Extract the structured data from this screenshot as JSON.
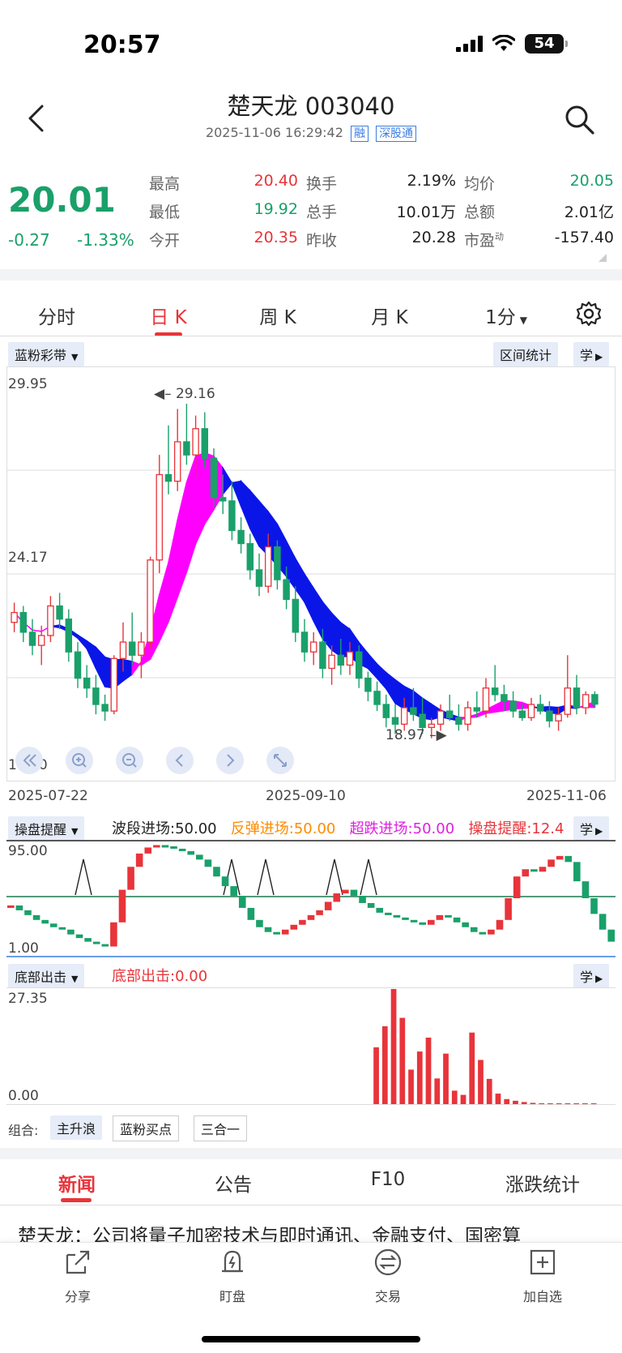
{
  "status_bar": {
    "time": "20:57",
    "battery": "54"
  },
  "header": {
    "title": "楚天龙 003040",
    "datetime": "2025-11-06 16:29:42",
    "tags": [
      "融",
      "深股通"
    ]
  },
  "quote": {
    "price": "20.01",
    "change": "-0.27",
    "change_pct": "-1.33%",
    "fields": [
      {
        "label": "最高",
        "value": "20.40",
        "color": "red"
      },
      {
        "label": "换手",
        "value": "2.19%",
        "color": "dark"
      },
      {
        "label": "均价",
        "value": "20.05",
        "color": "green"
      },
      {
        "label": "最低",
        "value": "19.92",
        "color": "green"
      },
      {
        "label": "总手",
        "value": "10.01万",
        "color": "dark"
      },
      {
        "label": "总额",
        "value": "2.01亿",
        "color": "dark"
      },
      {
        "label": "今开",
        "value": "20.35",
        "color": "red"
      },
      {
        "label": "昨收",
        "value": "20.28",
        "color": "dark"
      },
      {
        "label": "市盈",
        "value": "-157.40",
        "color": "dark",
        "sup": "动"
      }
    ]
  },
  "chart_tabs": {
    "items": [
      "分时",
      "日 K",
      "周 K",
      "月 K",
      "1分"
    ],
    "active": "日 K"
  },
  "kline_panel": {
    "indicator_label": "蓝粉彩带",
    "interval_stats": "区间统计",
    "learn": "学",
    "y_top": "29.95",
    "y_mid": "24.17",
    "y_bottom": "18.00",
    "high_label": "29.16",
    "low_label": "18.97",
    "x_labels": [
      "2025-07-22",
      "2025-09-10",
      "2025-11-06"
    ]
  },
  "osc_panel": {
    "indicator_label": "操盘提醒",
    "legend": [
      {
        "text": "波段进场:50.00",
        "color": "#222222"
      },
      {
        "text": "反弹进场:50.00",
        "color": "#ff8a00"
      },
      {
        "text": "超跌进场:50.00",
        "color": "#e020e0"
      },
      {
        "text": "操盘提醒:12.4",
        "color": "#e8343a"
      }
    ],
    "learn": "学",
    "y_top": "95.00",
    "y_bottom": "1.00"
  },
  "bottom_panel": {
    "indicator_label": "底部出击",
    "legend": "底部出击:0.00",
    "learn": "学",
    "y_top": "27.35",
    "y_bottom": "0.00"
  },
  "combos": {
    "label": "组合:",
    "items": [
      "主升浪",
      "蓝粉买点",
      "三合一"
    ]
  },
  "news_tabs": {
    "items": [
      "新闻",
      "公告",
      "F10",
      "涨跌统计"
    ],
    "active": "新闻"
  },
  "news_headline": "楚天龙：公司将量子加密技术与即时通讯、金融支付、国密算",
  "bottom_bar": {
    "items": [
      "分享",
      "盯盘",
      "交易",
      "加自选"
    ]
  },
  "colors": {
    "up": "#e8343a",
    "down": "#1aa06a",
    "band_down": "#0a16e8",
    "band_up": "#ff00ff"
  },
  "chart_data": [
    {
      "type": "candlestick",
      "title": "",
      "x_labels": [
        "2025-07-22",
        "2025-09-10",
        "2025-11-06"
      ],
      "ylim": [
        18.0,
        29.95
      ],
      "candles": [
        [
          22.5,
          23.1,
          22.2,
          22.8
        ],
        [
          22.8,
          23.0,
          21.9,
          22.2
        ],
        [
          22.2,
          22.6,
          21.5,
          21.8
        ],
        [
          21.8,
          22.4,
          21.2,
          22.1
        ],
        [
          22.1,
          23.3,
          21.9,
          23.0
        ],
        [
          23.0,
          23.4,
          22.3,
          22.6
        ],
        [
          22.6,
          22.9,
          21.3,
          21.6
        ],
        [
          21.6,
          21.9,
          20.5,
          20.8
        ],
        [
          20.8,
          21.2,
          20.2,
          20.5
        ],
        [
          20.5,
          20.9,
          19.7,
          20.0
        ],
        [
          20.0,
          20.3,
          19.5,
          19.8
        ],
        [
          19.8,
          21.5,
          19.7,
          21.4
        ],
        [
          21.4,
          22.5,
          21.0,
          21.9
        ],
        [
          21.9,
          22.8,
          21.2,
          21.5
        ],
        [
          21.5,
          22.2,
          20.8,
          21.9
        ],
        [
          21.9,
          24.5,
          21.7,
          24.4
        ],
        [
          24.4,
          27.6,
          24.0,
          27.0
        ],
        [
          27.0,
          28.5,
          26.4,
          26.8
        ],
        [
          26.8,
          29.0,
          26.5,
          28.0
        ],
        [
          28.0,
          29.16,
          27.3,
          27.6
        ],
        [
          27.6,
          28.8,
          26.9,
          28.4
        ],
        [
          28.4,
          28.9,
          27.2,
          27.5
        ],
        [
          27.5,
          27.8,
          26.0,
          26.3
        ],
        [
          26.3,
          27.0,
          25.8,
          26.2
        ],
        [
          26.2,
          26.8,
          25.0,
          25.3
        ],
        [
          25.3,
          25.7,
          24.6,
          24.9
        ],
        [
          24.9,
          25.2,
          23.8,
          24.1
        ],
        [
          24.1,
          24.6,
          23.3,
          23.6
        ],
        [
          23.6,
          25.2,
          23.4,
          24.8
        ],
        [
          24.8,
          25.0,
          23.5,
          23.8
        ],
        [
          23.8,
          24.2,
          22.9,
          23.2
        ],
        [
          23.2,
          23.6,
          21.9,
          22.2
        ],
        [
          22.2,
          22.6,
          21.3,
          21.6
        ],
        [
          21.6,
          22.2,
          21.2,
          21.9
        ],
        [
          21.9,
          22.3,
          20.8,
          21.1
        ],
        [
          21.1,
          21.8,
          20.6,
          21.5
        ],
        [
          21.5,
          22.0,
          20.9,
          21.2
        ],
        [
          21.2,
          21.9,
          20.9,
          21.6
        ],
        [
          21.6,
          21.8,
          20.5,
          20.8
        ],
        [
          20.8,
          21.0,
          20.1,
          20.4
        ],
        [
          20.4,
          20.7,
          19.8,
          20.0
        ],
        [
          20.0,
          20.3,
          19.3,
          19.6
        ],
        [
          19.6,
          20.0,
          19.1,
          19.4
        ],
        [
          19.4,
          20.2,
          19.2,
          19.9
        ],
        [
          19.9,
          20.5,
          19.5,
          19.7
        ],
        [
          19.7,
          20.2,
          19.1,
          19.3
        ],
        [
          19.3,
          19.6,
          18.97,
          19.4
        ],
        [
          19.4,
          20.0,
          19.2,
          19.8
        ],
        [
          19.8,
          20.3,
          19.5,
          19.6
        ],
        [
          19.6,
          20.0,
          19.2,
          19.4
        ],
        [
          19.4,
          20.1,
          19.2,
          19.9
        ],
        [
          19.9,
          20.4,
          19.6,
          19.8
        ],
        [
          19.8,
          20.8,
          19.6,
          20.5
        ],
        [
          20.5,
          21.2,
          20.1,
          20.3
        ],
        [
          20.3,
          20.6,
          19.8,
          20.1
        ],
        [
          20.1,
          20.4,
          19.6,
          19.8
        ],
        [
          19.8,
          20.0,
          19.5,
          19.6
        ],
        [
          19.6,
          20.2,
          19.5,
          20.0
        ],
        [
          20.0,
          20.3,
          19.7,
          19.8
        ],
        [
          19.8,
          20.1,
          19.3,
          19.5
        ],
        [
          19.5,
          19.9,
          19.2,
          19.7
        ],
        [
          19.7,
          21.5,
          19.6,
          20.5
        ],
        [
          20.5,
          20.9,
          19.7,
          19.9
        ],
        [
          19.9,
          20.4,
          19.7,
          20.3
        ],
        [
          20.3,
          20.4,
          19.92,
          20.01
        ]
      ]
    },
    {
      "type": "bar",
      "title": "",
      "ylim": [
        1.0,
        95.0
      ],
      "series": [
        {
          "name": "操盘提醒",
          "values": [
            42,
            38,
            34,
            30,
            27,
            24,
            22,
            18,
            15,
            12,
            10,
            8,
            28,
            55,
            74,
            85,
            90,
            92,
            91,
            89,
            87,
            84,
            80,
            74,
            66,
            58,
            50,
            40,
            30,
            24,
            20,
            18,
            22,
            26,
            30,
            34,
            38,
            45,
            52,
            55,
            50,
            44,
            40,
            36,
            34,
            32,
            30,
            28,
            26,
            30,
            34,
            32,
            28,
            24,
            20,
            18,
            22,
            30,
            48,
            66,
            72,
            70,
            74,
            80,
            83,
            78,
            62,
            48,
            35,
            22,
            12
          ]
        }
      ]
    },
    {
      "type": "bar",
      "title": "",
      "ylim": [
        0.0,
        27.35
      ],
      "series": [
        {
          "name": "底部出击",
          "values": [
            0,
            0,
            0,
            0,
            0,
            0,
            0,
            0,
            0,
            0,
            0,
            0,
            0,
            0,
            0,
            0,
            0,
            0,
            0,
            0,
            0,
            0,
            0,
            0,
            0,
            0,
            0,
            0,
            0,
            0,
            0,
            0,
            0,
            0,
            0,
            0,
            0,
            0,
            0,
            0,
            0,
            0,
            13.5,
            18.5,
            27.35,
            20.5,
            8.2,
            12.5,
            15.8,
            6.1,
            12.0,
            3.2,
            2.2,
            17.0,
            10.5,
            6.0,
            2.5,
            1.2,
            0.8,
            0.5,
            0.3,
            0.2,
            0.1,
            0.1,
            0.1,
            0.1,
            0.1,
            0.1,
            0,
            0
          ]
        }
      ]
    }
  ]
}
